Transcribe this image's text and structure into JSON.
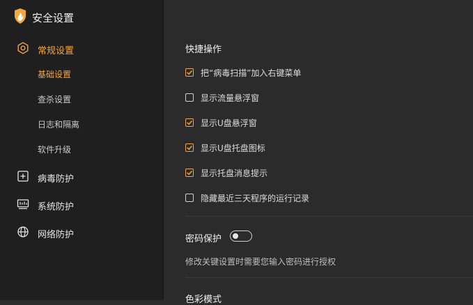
{
  "app": {
    "title": "安全设置"
  },
  "colors": {
    "accent": "#f5a73b",
    "sidebar_bg": "#1f1f1f",
    "main_bg": "#2b2b2b"
  },
  "sidebar": {
    "groups": [
      {
        "label": "常规设置",
        "icon": "gear-icon",
        "active": true,
        "items": [
          {
            "label": "基础设置",
            "active": true
          },
          {
            "label": "查杀设置"
          },
          {
            "label": "日志和隔离"
          },
          {
            "label": "软件升级"
          }
        ]
      },
      {
        "label": "病毒防护",
        "icon": "plus-box-icon"
      },
      {
        "label": "系统防护",
        "icon": "system-monitor-icon"
      },
      {
        "label": "网络防护",
        "icon": "globe-icon"
      }
    ]
  },
  "main": {
    "quick": {
      "title": "快捷操作",
      "options": [
        {
          "label": "把“病毒扫描”加入右键菜单",
          "checked": true
        },
        {
          "label": "显示流量悬浮窗",
          "checked": false
        },
        {
          "label": "显示U盘悬浮窗",
          "checked": true
        },
        {
          "label": "显示U盘托盘图标",
          "checked": true
        },
        {
          "label": "显示托盘消息提示",
          "checked": true
        },
        {
          "label": "隐藏最近三天程序的运行记录",
          "checked": false
        }
      ]
    },
    "password": {
      "title": "密码保护",
      "enabled": false,
      "description": "修改关键设置时需要您输入密码进行授权"
    },
    "color_mode": {
      "title": "色彩模式"
    }
  }
}
